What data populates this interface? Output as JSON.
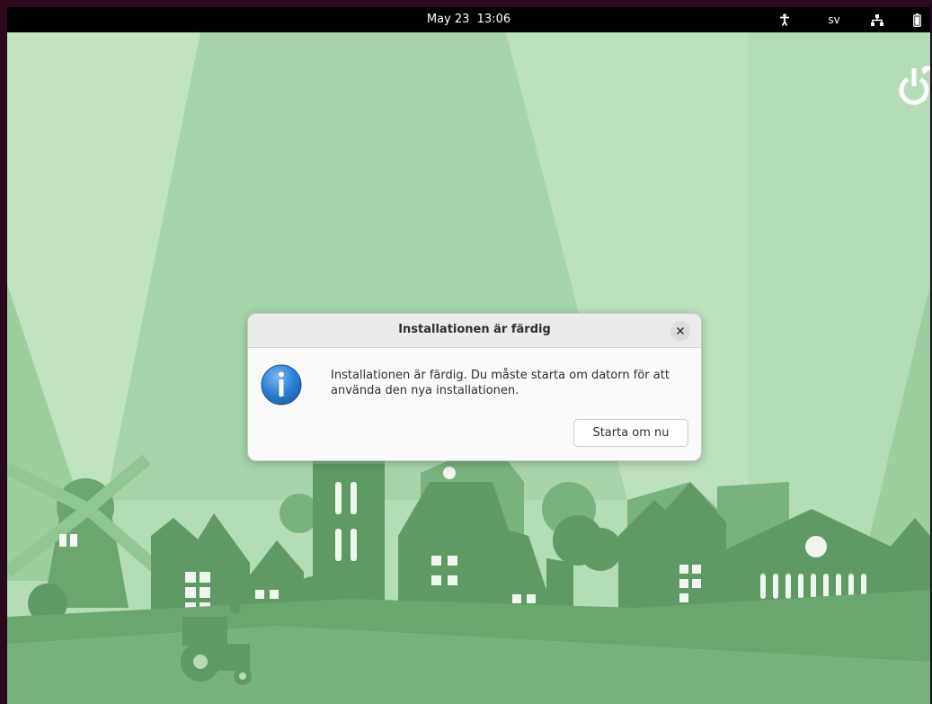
{
  "topbar": {
    "datetime": "May 23  13:06",
    "language": "sv",
    "icons": [
      "accessibility-icon",
      "network-icon",
      "battery-icon"
    ]
  },
  "wallpaper": {
    "logo": "power-icon"
  },
  "dialog": {
    "title": "Installationen är färdig",
    "message": "Installationen är färdig. Du måste starta om datorn för att använda den nya installationen.",
    "button_label": "Starta om nu",
    "icon": "info-icon",
    "close_icon": "close-icon"
  },
  "colors": {
    "topbar": "#000000",
    "wallpaper_light": "#b4dcb6",
    "wallpaper_dark": "#5f9a66",
    "info_blue": "#2a7fd4"
  }
}
